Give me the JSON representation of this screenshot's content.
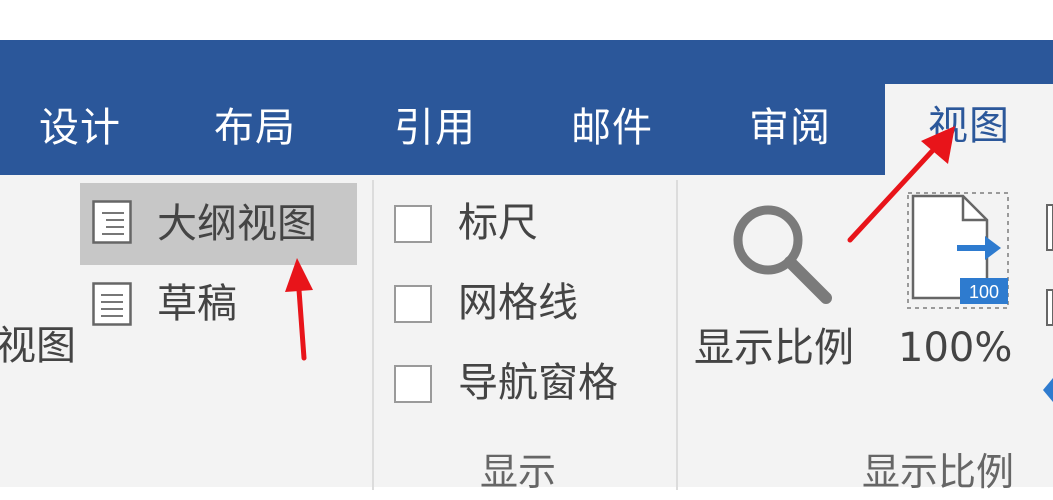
{
  "tabs": [
    {
      "label": "设计"
    },
    {
      "label": "布局"
    },
    {
      "label": "引用"
    },
    {
      "label": "邮件"
    },
    {
      "label": "审阅"
    },
    {
      "label": "视图"
    }
  ],
  "ribbon": {
    "views_group": {
      "left_label": "视图",
      "outline_view": "大纲视图",
      "draft": "草稿"
    },
    "show_group": {
      "ruler": "标尺",
      "gridlines": "网格线",
      "nav_pane": "导航窗格",
      "group_label": "显示"
    },
    "zoom_group": {
      "zoom": "显示比例",
      "percent": "100%",
      "icon_value": "100",
      "group_label": "显示比例"
    }
  },
  "colors": {
    "title_bar": "#2b579a",
    "ribbon_bg": "#f3f3f3",
    "highlight": "#c7c7c7",
    "arrow": "#e8141a"
  },
  "icons": [
    "outline-view-icon",
    "draft-icon",
    "magnifier-icon",
    "page-100-icon",
    "checkbox-icon"
  ]
}
